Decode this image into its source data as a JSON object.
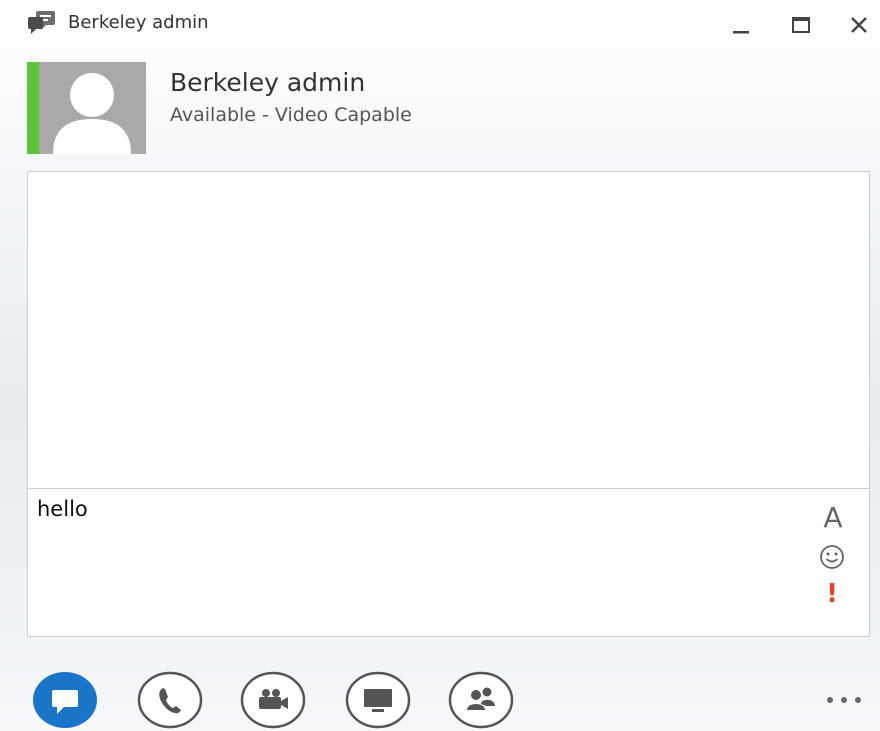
{
  "window": {
    "title": "Berkeley admin",
    "controls": {
      "minimize": "minimize-icon",
      "maximize": "maximize-icon",
      "close": "close-icon"
    }
  },
  "contact": {
    "name": "Berkeley admin",
    "status": "Available - Video Capable",
    "presence_color": "#5cc33a"
  },
  "compose": {
    "text": "hello",
    "font_button": "A",
    "emoticon_icon": "smiley-icon",
    "priority_button": "!"
  },
  "actions": {
    "items": [
      {
        "name": "im-button",
        "icon": "chat-bubble-icon",
        "active": true
      },
      {
        "name": "call-button",
        "icon": "phone-icon"
      },
      {
        "name": "video-button",
        "icon": "video-camera-icon"
      },
      {
        "name": "present-button",
        "icon": "monitor-icon"
      },
      {
        "name": "participants-button",
        "icon": "people-icon"
      }
    ],
    "more": "more-options-icon"
  },
  "colors": {
    "accent": "#1a74c8",
    "presence": "#5cc33a",
    "priority": "#e2452b"
  }
}
